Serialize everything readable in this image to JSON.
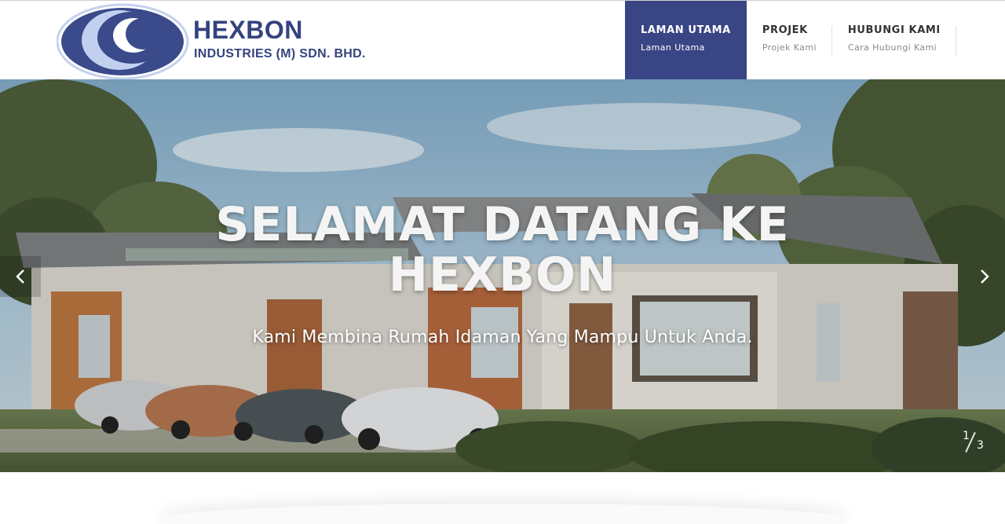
{
  "brand": {
    "name": "HEXBON",
    "subtitle": "INDUSTRIES (M) SDN. BHD.",
    "colors": {
      "primary": "#34437e",
      "accent_light": "#b7c8ee"
    }
  },
  "nav": {
    "items": [
      {
        "title": "LAMAN UTAMA",
        "subtitle": "Laman Utama",
        "active": true
      },
      {
        "title": "PROJEK",
        "subtitle": "Projek Kami",
        "active": false
      },
      {
        "title": "HUBUNGI KAMI",
        "subtitle": "Cara Hubungi Kami",
        "active": false
      }
    ],
    "active_color": "#3a4585"
  },
  "hero": {
    "title_line1": "SELAMAT DATANG KE",
    "title_line2": "HEXBON",
    "subtitle": "Kami Membina Rumah Idaman Yang Mampu Untuk Anda.",
    "prev_icon": "chevron-left-icon",
    "next_icon": "chevron-right-icon",
    "slide_current": "1",
    "slide_total": "3"
  }
}
